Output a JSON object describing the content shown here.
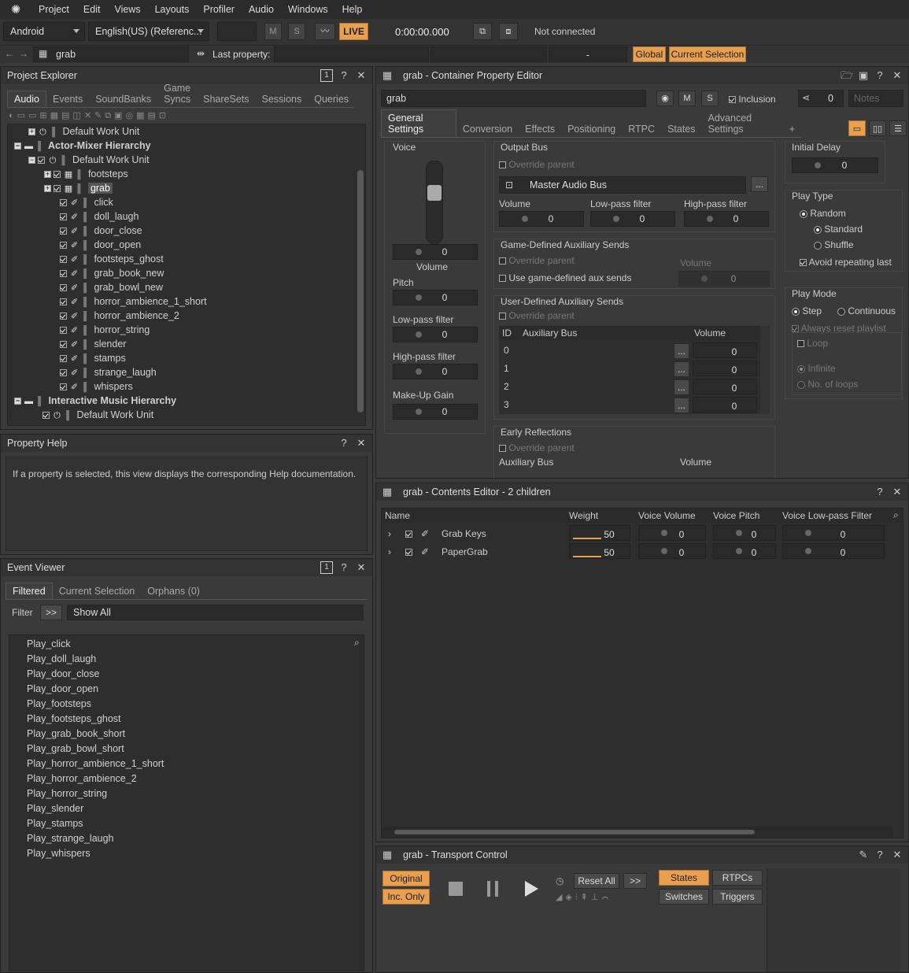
{
  "menu": {
    "items": [
      "Project",
      "Edit",
      "Views",
      "Layouts",
      "Profiler",
      "Audio",
      "Windows",
      "Help"
    ]
  },
  "toolbar": {
    "platform": "Android",
    "language": "English(US) (Referenc...",
    "m_label": "M",
    "s_label": "S",
    "live_label": "LIVE",
    "time": "0:00:00.000",
    "connection": "Not connected"
  },
  "address": {
    "object": "grab",
    "last_property_label": "Last property:",
    "dash": "-",
    "global": "Global",
    "current_selection": "Current Selection"
  },
  "project_explorer": {
    "title": "Project Explorer",
    "count": "1",
    "tabs": [
      "Audio",
      "Events",
      "SoundBanks",
      "Game Syncs",
      "ShareSets",
      "Sessions",
      "Queries"
    ],
    "tree": [
      {
        "label": "Default Work Unit"
      },
      {
        "label": "Actor-Mixer Hierarchy"
      },
      {
        "label": "Default Work Unit"
      },
      {
        "label": "footsteps"
      },
      {
        "label": "grab"
      },
      {
        "label": "click"
      },
      {
        "label": "doll_laugh"
      },
      {
        "label": "door_close"
      },
      {
        "label": "door_open"
      },
      {
        "label": "footsteps_ghost"
      },
      {
        "label": "grab_book_new"
      },
      {
        "label": "grab_bowl_new"
      },
      {
        "label": "horror_ambience_1_short"
      },
      {
        "label": "horror_ambience_2"
      },
      {
        "label": "horror_string"
      },
      {
        "label": "slender"
      },
      {
        "label": "stamps"
      },
      {
        "label": "strange_laugh"
      },
      {
        "label": "whispers"
      },
      {
        "label": "Interactive Music Hierarchy"
      },
      {
        "label": "Default Work Unit"
      }
    ]
  },
  "property_help": {
    "title": "Property Help",
    "text": "If a property is selected, this view displays the corresponding Help documentation."
  },
  "event_viewer": {
    "title": "Event Viewer",
    "count": "1",
    "tabs": [
      "Filtered",
      "Current Selection",
      "Orphans (0)"
    ],
    "filter_label": "Filter",
    "filter_button": ">>",
    "filter_value": "Show All",
    "events": [
      "Play_click",
      "Play_doll_laugh",
      "Play_door_close",
      "Play_door_open",
      "Play_footsteps",
      "Play_footsteps_ghost",
      "Play_grab_book_short",
      "Play_grab_bowl_short",
      "Play_horror_ambience_1_short",
      "Play_horror_ambience_2",
      "Play_horror_string",
      "Play_slender",
      "Play_stamps",
      "Play_strange_laugh",
      "Play_whispers"
    ]
  },
  "property_editor": {
    "title": "grab - Container Property Editor",
    "name": "grab",
    "m": "M",
    "s": "S",
    "inclusion": "Inclusion",
    "link_count": "0",
    "notes_placeholder": "Notes",
    "tabs": [
      "General Settings",
      "Conversion",
      "Effects",
      "Positioning",
      "RTPC",
      "States",
      "Advanced Settings",
      "+"
    ],
    "voice": {
      "title": "Voice",
      "volume_value": "0",
      "volume_label": "Volume",
      "pitch_label": "Pitch",
      "pitch_value": "0",
      "lpf_label": "Low-pass filter",
      "lpf_value": "0",
      "hpf_label": "High-pass filter",
      "hpf_value": "0",
      "makeup_label": "Make-Up Gain",
      "makeup_value": "0"
    },
    "output_bus": {
      "title": "Output Bus",
      "override": "Override parent",
      "bus": "Master Audio Bus",
      "browse": "...",
      "volume_label": "Volume",
      "volume": "0",
      "lpf_label": "Low-pass filter",
      "lpf": "0",
      "hpf_label": "High-pass filter",
      "hpf": "0"
    },
    "game_aux": {
      "title": "Game-Defined Auxiliary Sends",
      "override": "Override parent",
      "use": "Use game-defined aux sends",
      "volume_label": "Volume",
      "volume": "0"
    },
    "user_aux": {
      "title": "User-Defined Auxiliary Sends",
      "override": "Override parent",
      "col_id": "ID",
      "col_bus": "Auxiliary Bus",
      "col_volume": "Volume",
      "rows": [
        {
          "id": "0",
          "vol": "0"
        },
        {
          "id": "1",
          "vol": "0"
        },
        {
          "id": "2",
          "vol": "0"
        },
        {
          "id": "3",
          "vol": "0"
        }
      ],
      "browse": "..."
    },
    "early": {
      "title": "Early Reflections",
      "override": "Override parent",
      "bus_label": "Auxiliary Bus",
      "volume_label": "Volume"
    },
    "initial_delay": {
      "title": "Initial Delay",
      "value": "0"
    },
    "play_type": {
      "title": "Play Type",
      "random": "Random",
      "standard": "Standard",
      "shuffle": "Shuffle",
      "avoid": "Avoid repeating last"
    },
    "play_mode": {
      "title": "Play Mode",
      "step": "Step",
      "continuous": "Continuous",
      "always_reset": "Always reset playlist",
      "loop": "Loop",
      "infinite": "Infinite",
      "no_loops": "No. of loops"
    }
  },
  "contents_editor": {
    "title": "grab - Contents Editor - 2 children",
    "columns": [
      "Name",
      "Weight",
      "Voice Volume",
      "Voice Pitch",
      "Voice Low-pass Filter"
    ],
    "rows": [
      {
        "name": "Grab Keys",
        "weight": "50",
        "volume": "0",
        "pitch": "0",
        "lpf": "0"
      },
      {
        "name": "PaperGrab",
        "weight": "50",
        "volume": "0",
        "pitch": "0",
        "lpf": "0"
      }
    ]
  },
  "transport": {
    "title": "grab - Transport Control",
    "original": "Original",
    "inc_only": "Inc. Only",
    "reset_all": "Reset All",
    "more": ">>",
    "states": "States",
    "rtpcs": "RTPCs",
    "switches": "Switches",
    "triggers": "Triggers"
  },
  "colors": {
    "accent": "#e8a050",
    "bg": "#3a3a3a",
    "dark": "#2a2a2a"
  }
}
